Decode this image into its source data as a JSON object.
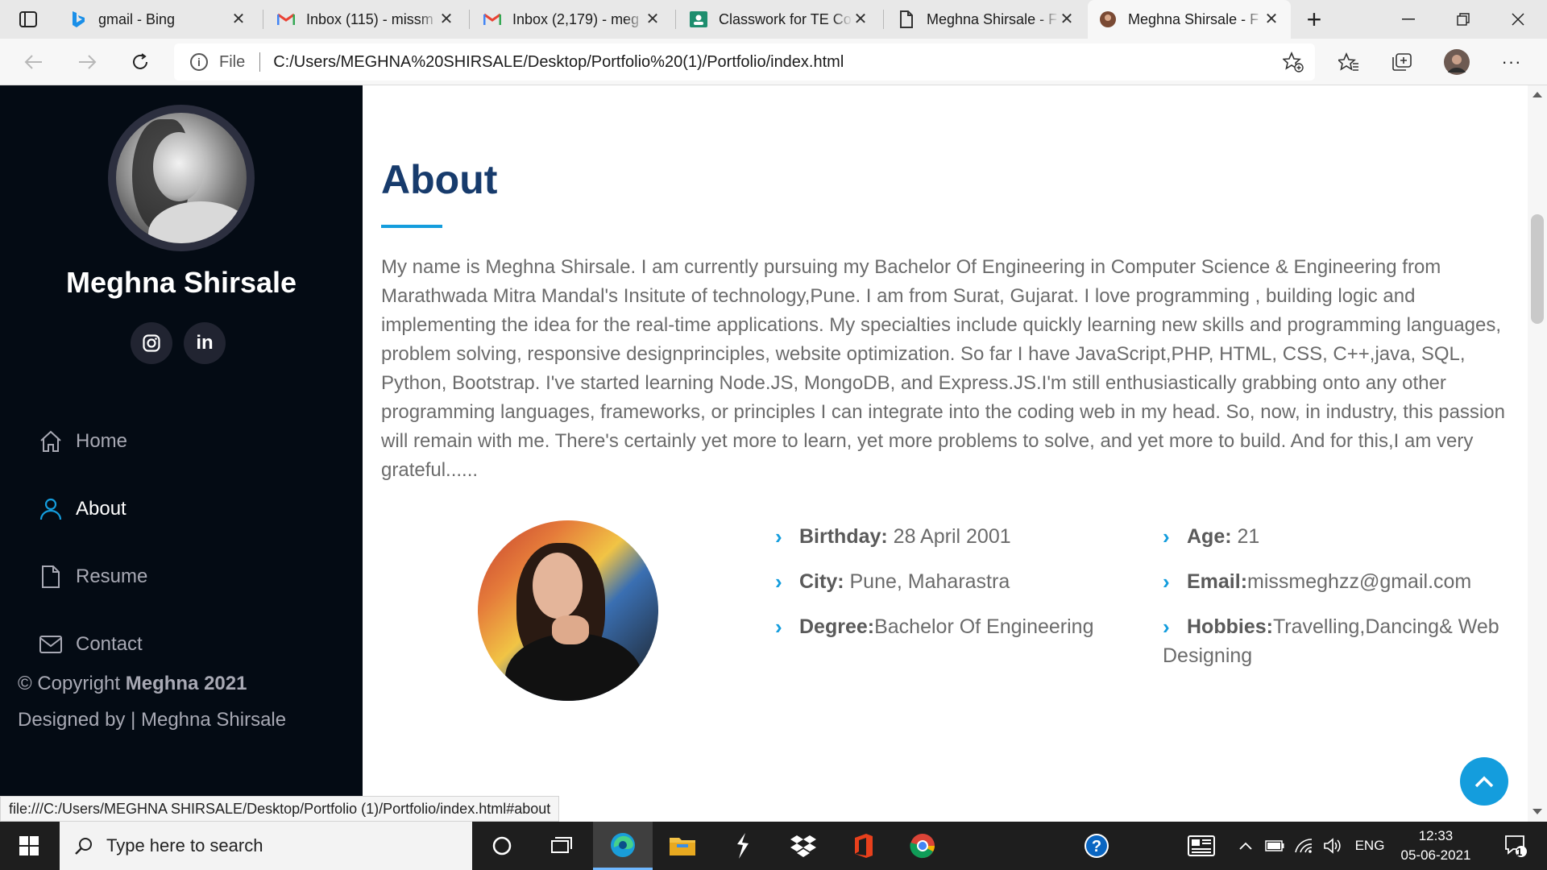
{
  "browser": {
    "tabs": [
      {
        "title": "gmail - Bing",
        "icon": "bing-icon"
      },
      {
        "title": "Inbox (115) - missm",
        "icon": "gmail-icon"
      },
      {
        "title": "Inbox (2,179) - meg",
        "icon": "gmail-icon"
      },
      {
        "title": "Classwork for TE Co",
        "icon": "classroom-icon"
      },
      {
        "title": "Meghna Shirsale - F",
        "icon": "page-icon"
      },
      {
        "title": "Meghna Shirsale - F",
        "icon": "avatar-icon"
      }
    ],
    "address": {
      "scheme_label": "File",
      "url": "C:/Users/MEGHNA%20SHIRSALE/Desktop/Portfolio%20(1)/Portfolio/index.html"
    },
    "status_url": "file:///C:/Users/MEGHNA SHIRSALE/Desktop/Portfolio (1)/Portfolio/index.html#about"
  },
  "sidebar": {
    "name": "Meghna Shirsale",
    "socials": [
      {
        "icon": "instagram-icon"
      },
      {
        "label": "in",
        "icon": "linkedin-icon"
      }
    ],
    "nav": [
      {
        "label": "Home",
        "icon": "home-icon"
      },
      {
        "label": "About",
        "icon": "person-icon",
        "active": true
      },
      {
        "label": "Resume",
        "icon": "file-icon"
      },
      {
        "label": "Contact",
        "icon": "envelope-icon"
      }
    ],
    "footer": {
      "copyright_prefix": "© Copyright",
      "copyright_bold": "Meghna 2021",
      "designed_by": "Designed by | Meghna Shirsale"
    }
  },
  "about": {
    "title": "About",
    "text": "My name is Meghna Shirsale. I am currently pursuing my Bachelor Of Engineering in Computer Science & Engineering from Marathwada Mitra Mandal's Insitute of technology,Pune. I am from Surat, Gujarat. I love programming , building logic and implementing the idea for the real-time applications. My specialties include quickly learning new skills and programming languages, problem solving, responsive designprinciples, website optimization. So far I have JavaScript,PHP, HTML, CSS, C++,java, SQL, Python, Bootstrap. I've started learning Node.JS, MongoDB, and Express.JS.I'm still enthusiastically grabbing onto any other programming languages, frameworks, or principles I can integrate into the coding web in my head. So, now, in industry, this passion will remain with me. There's certainly yet more to learn, yet more problems to solve, and yet more to build. And for this,I am very grateful......",
    "details_left": [
      {
        "label": "Birthday:",
        "value": " 28 April 2001"
      },
      {
        "label": "City:",
        "value": " Pune, Maharastra"
      },
      {
        "label": "Degree:",
        "value": "Bachelor Of Engineering"
      }
    ],
    "details_right": [
      {
        "label": "Age:",
        "value": " 21"
      },
      {
        "label": "Email:",
        "value": "missmeghzz@gmail.com"
      },
      {
        "label": "Hobbies:",
        "value": "Travelling,Dancing& Web Designing"
      }
    ]
  },
  "taskbar": {
    "search_placeholder": "Type here to search",
    "language": "ENG",
    "time": "12:33",
    "date": "05-06-2021",
    "notification_count": "1"
  },
  "colors": {
    "sidebar_bg": "#040b14",
    "accent": "#149ddd",
    "heading": "#173b6c",
    "body_text": "#6b6b6b"
  }
}
